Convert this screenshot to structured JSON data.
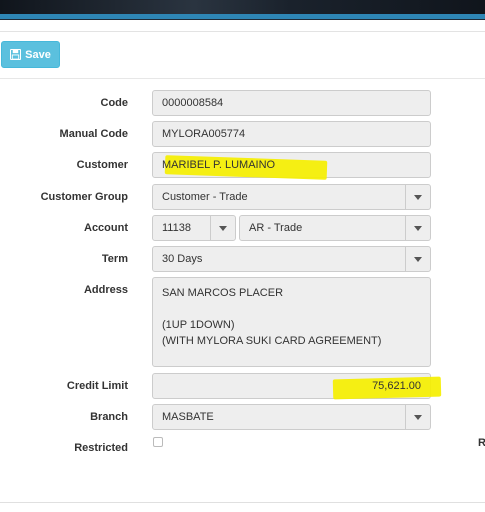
{
  "toolbar": {
    "save_label": "Save",
    "save_icon": "floppy-disk-icon"
  },
  "form": {
    "code": {
      "label": "Code",
      "value": "0000008584"
    },
    "manual_code": {
      "label": "Manual Code",
      "value": "MYLORA005774"
    },
    "customer": {
      "label": "Customer",
      "value": "MARIBEL P. LUMAINO"
    },
    "customer_group": {
      "label": "Customer Group",
      "value": "Customer - Trade"
    },
    "account": {
      "label": "Account",
      "code_value": "11138",
      "name_value": "AR - Trade"
    },
    "term": {
      "label": "Term",
      "value": "30 Days"
    },
    "address": {
      "label": "Address",
      "value": "SAN MARCOS PLACER\n\n(1UP 1DOWN)\n(WITH MYLORA SUKI CARD AGREEMENT)"
    },
    "credit_limit": {
      "label": "Credit Limit",
      "value": "75,621.00"
    },
    "branch": {
      "label": "Branch",
      "value": "MASBATE"
    },
    "restricted": {
      "label": "Restricted",
      "checked": false
    },
    "right_edge_label": "R"
  },
  "colors": {
    "save_button": "#5bc0de",
    "highlight": "#f5ef00",
    "field_bg": "#eeeeee"
  }
}
